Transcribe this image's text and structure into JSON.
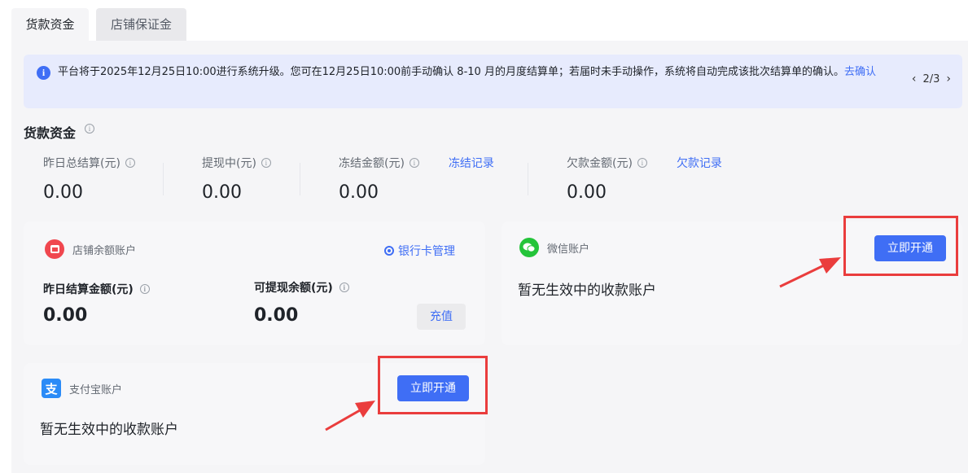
{
  "tabs": [
    {
      "label": "货款资金",
      "active": true
    },
    {
      "label": "店铺保证金",
      "active": false
    }
  ],
  "notice": {
    "icon": "info-icon",
    "text": "平台将于2025年12月25日10:00进行系统升级。您可在12月25日10:00前手动确认 8-10 月的月度结算单；若届时未手动操作，系统将自动完成该批次结算单的确认。",
    "link": "去确认",
    "pager": "2/3"
  },
  "section": {
    "title": "货款资金"
  },
  "stats": [
    {
      "label": "昨日总结算(元)",
      "value": "0.00"
    },
    {
      "label": "提现中(元)",
      "value": "0.00"
    },
    {
      "label": "冻结金额(元)",
      "value": "0.00",
      "link": "冻结记录"
    },
    {
      "label": "欠款金额(元)",
      "value": "0.00",
      "link": "欠款记录"
    }
  ],
  "store_account": {
    "title": "店铺余额账户",
    "bank_link": "银行卡管理",
    "settled_label": "昨日结算金额(元)",
    "settled_value": "0.00",
    "withdrawable_label": "可提现余额(元)",
    "withdrawable_value": "0.00",
    "recharge": "充值"
  },
  "wechat_account": {
    "title": "微信账户",
    "open_button": "立即开通",
    "empty_text": "暂无生效中的收款账户"
  },
  "alipay_account": {
    "title": "支付宝账户",
    "logo_char": "支",
    "open_button": "立即开通",
    "empty_text": "暂无生效中的收款账户"
  },
  "colors": {
    "accent": "#3f6ef5",
    "annotation": "#ea3d3d",
    "notice_bg": "#e7ebfd"
  }
}
